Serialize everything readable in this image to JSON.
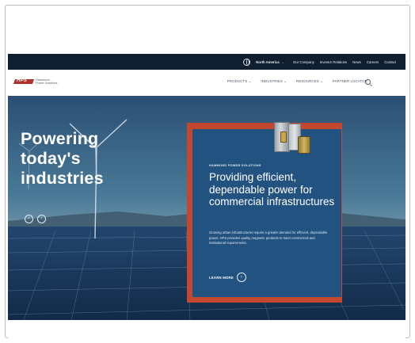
{
  "topbar": {
    "region": "North America",
    "links": [
      "Our Company",
      "Investor Relations",
      "News",
      "Careers",
      "Contact"
    ],
    "icons": [
      "globe-icon"
    ]
  },
  "brand": {
    "mark": "HPS",
    "name_line1": "Hammond",
    "name_line2": "Power Solutions",
    "accent_color": "#b0302a"
  },
  "nav": {
    "items": [
      "PRODUCTS",
      "INDUSTRIES",
      "RESOURCES",
      "PARTNER LOCATOR"
    ],
    "chevron": "⌄",
    "search_icon": "search-icon"
  },
  "hero": {
    "title_lines": [
      "Powering",
      "today's",
      "industries"
    ],
    "prev_glyph": "‹",
    "next_glyph": "›",
    "card": {
      "eyebrow": "HAMMOND POWER SOLUTIONS",
      "heading": "Providing efficient, dependable power for commercial infrastructures",
      "body": "Growing urban infrastructures require a greater demand for efficient, dependable power. HPS provides quality magnetic products to meet commercial and institutional requirements.",
      "cta": "LEARN MORE",
      "cta_glyph": "›",
      "color": "#22527f",
      "accent": "#c2482f"
    }
  }
}
